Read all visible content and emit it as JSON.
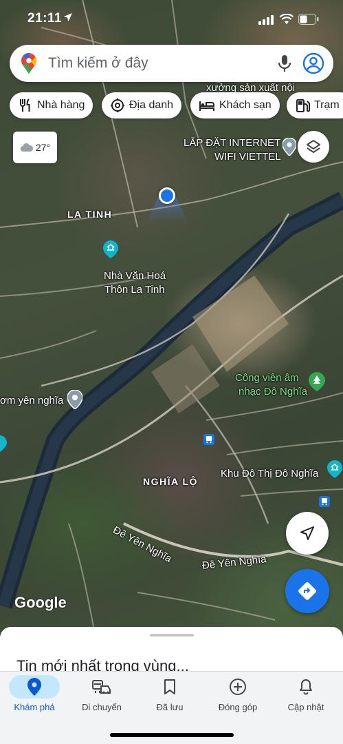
{
  "status_bar": {
    "time": "21:11"
  },
  "search": {
    "placeholder": "Tìm kiếm ở đây"
  },
  "chips": [
    {
      "label": "Nhà hàng",
      "icon": "fork-knife-icon"
    },
    {
      "label": "Địa danh",
      "icon": "landmark-icon"
    },
    {
      "label": "Khách sạn",
      "icon": "bed-icon"
    },
    {
      "label": "Trạm",
      "icon": "fuel-icon"
    }
  ],
  "weather": {
    "temp": "27°",
    "icon": "cloud-icon"
  },
  "map_labels": {
    "factory": "xưởng sản xuất nội",
    "internet_line1": "LẮP ĐẶT INTERNET",
    "internet_line2": "WIFI VIETTEL",
    "la_tinh": "LA TINH",
    "culture_house_line1": "Nhà Văn Hoá",
    "culture_house_line2": "Thôn La Tinh",
    "park_line1": "Công viên âm",
    "park_line2": "nhạc Đô Nghĩa",
    "yen_nghia": "ơm yên nghĩa",
    "nghia_lo": "NGHĨA LỘ",
    "urban_area": "Khu Đô Thị Đô Nghĩa",
    "road1": "Đê Yên Nghĩa",
    "road2": "Đê Yên Nghĩa"
  },
  "attribution": "Google",
  "sheet": {
    "title": "Tin mới nhất trong vùng..."
  },
  "bottom_nav": [
    {
      "label": "Khám phá",
      "icon": "explore-pin-icon",
      "active": true
    },
    {
      "label": "Di chuyển",
      "icon": "commute-icon",
      "active": false
    },
    {
      "label": "Đã lưu",
      "icon": "bookmark-icon",
      "active": false
    },
    {
      "label": "Đóng góp",
      "icon": "add-circle-icon",
      "active": false
    },
    {
      "label": "Cập nhật",
      "icon": "bell-icon",
      "active": false
    }
  ],
  "colors": {
    "accent": "#1a73e8",
    "active_pill": "#c2e7ff",
    "poi_teal": "#12b5cb",
    "park_green": "#34a853"
  }
}
